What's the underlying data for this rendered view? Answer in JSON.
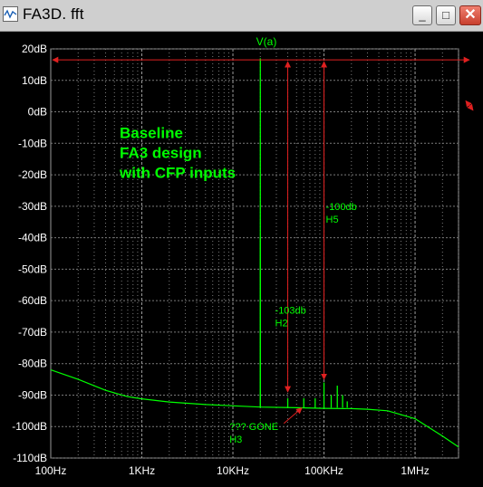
{
  "window": {
    "title": "FA3D. fft",
    "controls": {
      "minimize": "_",
      "maximize": "□",
      "close": "✕"
    },
    "icon": "waveform-icon"
  },
  "chart_data": {
    "type": "line",
    "title": "V(a)",
    "xscale": "log",
    "xlim": [
      100,
      3000000
    ],
    "ylim": [
      -110,
      20
    ],
    "x_ticks": [
      "100Hz",
      "1KHz",
      "10KHz",
      "100KHz",
      "1MHz"
    ],
    "y_ticks": [
      "20dB",
      "10dB",
      "0dB",
      "-10dB",
      "-20dB",
      "-30dB",
      "-40dB",
      "-50dB",
      "-60dB",
      "-70dB",
      "-80dB",
      "-90dB",
      "-100dB",
      "-110dB"
    ],
    "colors": {
      "trace": "#00ff00",
      "annotation": "#e02020",
      "grid": "#7a7a7a",
      "axis_text": "#ffffff"
    },
    "series": [
      {
        "noise_floor": [
          [
            100,
            -82
          ],
          [
            200,
            -85
          ],
          [
            400,
            -88.5
          ],
          [
            700,
            -90.5
          ],
          [
            1000,
            -91.2
          ],
          [
            2000,
            -92.2
          ],
          [
            5000,
            -93
          ],
          [
            10000,
            -93.4
          ],
          [
            20000,
            -93.8
          ],
          [
            50000,
            -94
          ],
          [
            100000,
            -94.2
          ],
          [
            200000,
            -94.3
          ],
          [
            300000,
            -94.5
          ],
          [
            500000,
            -95
          ],
          [
            1000000,
            -97.5
          ],
          [
            2000000,
            -103
          ],
          [
            3000000,
            -106.5
          ]
        ],
        "peaks": [
          [
            20000,
            17
          ],
          [
            20000,
            -40
          ],
          [
            40000,
            -91
          ],
          [
            60000,
            -91
          ],
          [
            80000,
            -91
          ],
          [
            100000,
            -86
          ],
          [
            120000,
            -90
          ],
          [
            140000,
            -87
          ],
          [
            160000,
            -90
          ],
          [
            180000,
            -92
          ]
        ]
      }
    ],
    "annotations": {
      "main_text": [
        "Baseline",
        "FA3 design",
        "with CFP inputs"
      ],
      "label_h2": [
        "-103db",
        "H2"
      ],
      "label_h5": [
        "-100db",
        "H5"
      ],
      "label_h3": [
        "??? GONE",
        "H3"
      ],
      "reference_level_db": 16.5,
      "arrow_h2_x": 40000,
      "arrow_h2_bottom_db": -89,
      "arrow_h5_x": 100000,
      "arrow_h5_bottom_db": -85,
      "arrow_h3_target": [
        60000,
        -93.5
      ]
    }
  }
}
